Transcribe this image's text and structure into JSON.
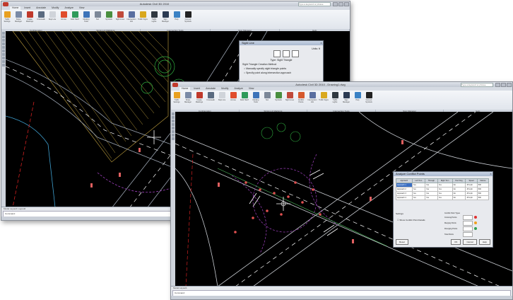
{
  "back_window": {
    "title": "Autodesk Civil 3D 2010",
    "search_placeholder": "Type a keyword or phrase",
    "tabs": [
      "Home",
      "Insert",
      "Annotate",
      "Modify",
      "Analyze",
      "View"
    ],
    "ribbon_buttons": [
      "Traffic Settings",
      "Stripe Manager",
      "Create Markings",
      "Crosswalk",
      "Stop Line",
      "Arrows",
      "Solid Hatch",
      "Marking Tools",
      "Text",
      "Symbols",
      "Sight Lines",
      "Intersection Info",
      "Traffic Signs",
      "Traffic Lights",
      "Sign Manager",
      "Help",
      "Convert Symbols"
    ],
    "ribbon_panels": [
      "Configuration",
      "Striping & Markings",
      "Intersection Tools",
      "Sign Manager",
      "Help"
    ],
    "command_tabs": [
      "Model",
      "Layout1",
      "Layout2"
    ],
    "command_prompt": "Command:"
  },
  "sight_dialog": {
    "title": "Sight Line",
    "units": "Units: ft",
    "type_label": "Type: Sight Triangle",
    "group_label": "Sight Triangle Creation Method",
    "option_1": "Manually specify sight triangle points",
    "option_2": "Specify point along intersection approach"
  },
  "front_window": {
    "title": "Autodesk Civil 3D 2010 - Drawing1.dwg",
    "search_placeholder": "Type a keyword or phrase",
    "tabs": [
      "Home",
      "Insert",
      "Annotate",
      "Modify",
      "Analyze",
      "View"
    ],
    "ribbon_buttons": [
      "Traffic Settings",
      "Stripe Manager",
      "Create Markings",
      "Crosswalk",
      "Stop Line",
      "Arrows",
      "Solid Hatch",
      "Marking Tools",
      "Text",
      "Symbols",
      "Sight Lines",
      "Conflict Points",
      "Intersection Info",
      "Traffic Signs",
      "Traffic Lights",
      "Sign Manager",
      "Help",
      "Convert Symbols"
    ],
    "ribbon_panels": [
      "Configuration",
      "Striping & Markings",
      "Intersection Tools",
      "Sign Manager",
      "Help"
    ],
    "command_tabs": [
      "Model",
      "Layout1"
    ],
    "command_prompt": "Command:"
  },
  "conflict_dialog": {
    "title": "Analyze Conflict Points",
    "columns": [
      "Approach",
      "Left Turn",
      "Through",
      "Right Turn",
      "Ped Xing",
      "Speed",
      "Volume"
    ],
    "rows": [
      [
        "Approach 1",
        "Yes",
        "Yes",
        "Yes",
        "No",
        "45 mph",
        "500"
      ],
      [
        "Approach 2",
        "Yes",
        "Yes",
        "Yes",
        "No",
        "45 mph",
        "500"
      ],
      [
        "Approach 3",
        "Yes",
        "Yes",
        "Yes",
        "No",
        "45 mph",
        "500"
      ],
      [
        "Approach 4",
        "Yes",
        "Yes",
        "Yes",
        "No",
        "45 mph",
        "500"
      ]
    ],
    "settings_label": "Settings",
    "checkbox_label": "Show Conflict Point Details",
    "conflict_types_label": "Conflict Point Types",
    "conflict_types": [
      {
        "name": "Crossing Points",
        "color": "#e03030"
      },
      {
        "name": "Merging Points",
        "color": "#f0a020"
      },
      {
        "name": "Diverging Points",
        "color": "#30a050"
      },
      {
        "name": "Total Points",
        "color": "#000000"
      }
    ],
    "reset_label": "Reset",
    "ok_label": "OK",
    "cancel_label": "Cancel",
    "help_label": "Help"
  }
}
